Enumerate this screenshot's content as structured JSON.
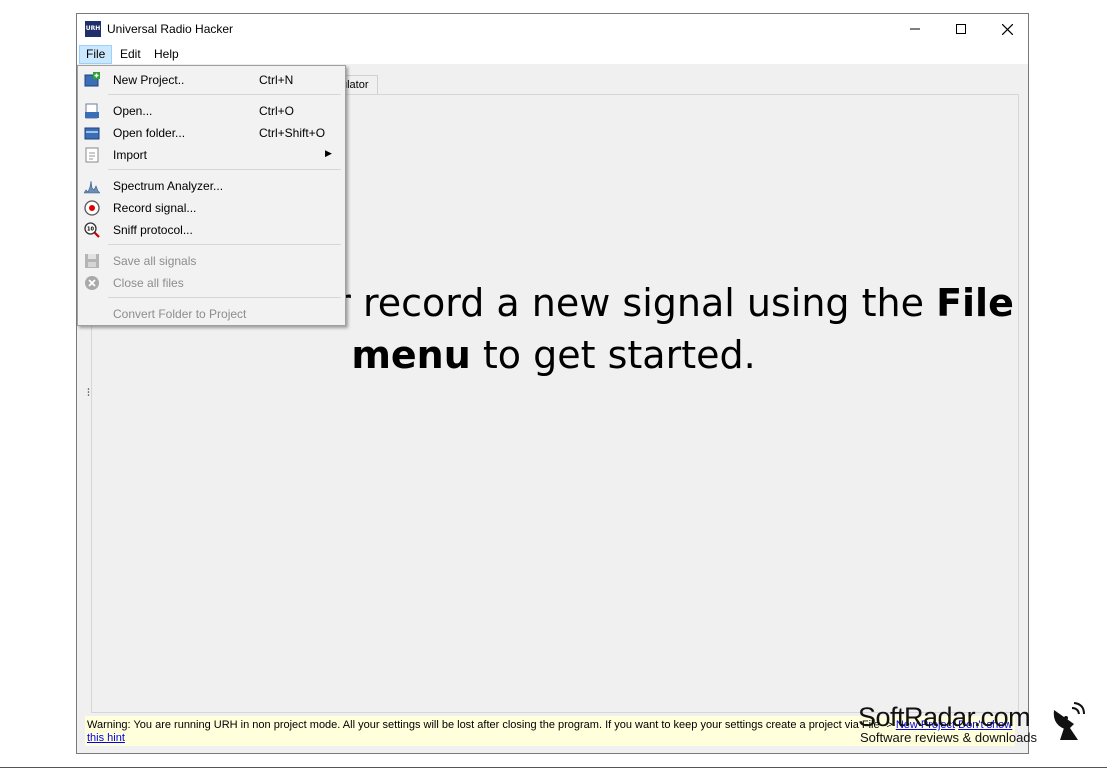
{
  "window": {
    "title": "Universal Radio Hacker",
    "icon_text": "URH"
  },
  "menubar": {
    "file": "File",
    "edit": "Edit",
    "help": "Help"
  },
  "tab": {
    "visible_label": "ulator"
  },
  "file_menu": {
    "new_project": {
      "label": "New Project..",
      "shortcut": "Ctrl+N"
    },
    "open": {
      "label": "Open...",
      "shortcut": "Ctrl+O"
    },
    "open_folder": {
      "label": "Open folder...",
      "shortcut": "Ctrl+Shift+O"
    },
    "import": {
      "label": "Import"
    },
    "spectrum_analyzer": {
      "label": "Spectrum Analyzer..."
    },
    "record_signal": {
      "label": "Record signal..."
    },
    "sniff_protocol": {
      "label": "Sniff protocol..."
    },
    "save_all_signals": {
      "label": "Save all signals"
    },
    "close_all_files": {
      "label": "Close all files"
    },
    "convert_folder": {
      "label": "Convert Folder to Project"
    }
  },
  "hint": {
    "part1": "Open a file or record a new signal using the ",
    "bold1": "File",
    "bold2": "menu",
    "part2": " to get started."
  },
  "warning": {
    "text": "Warning: You are running URH in non project mode. All your settings will be lost after closing the program. If you want to keep your settings create a project via File -> ",
    "link_new_project": "New Project",
    "link_dont_show": "Don't show",
    "link_this_hint": "this hint"
  },
  "watermark": {
    "title": "SoftRadar.com",
    "subtitle": "Software reviews & downloads"
  }
}
